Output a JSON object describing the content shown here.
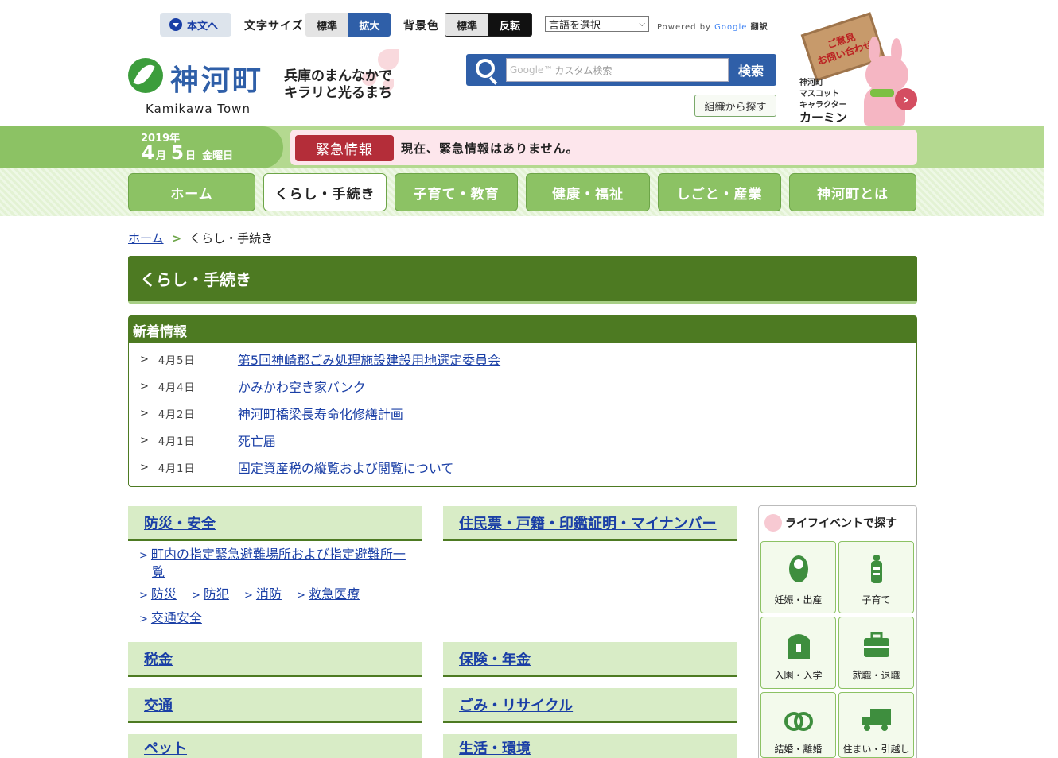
{
  "utility": {
    "skip_label": "本文へ",
    "font_size_label": "文字サイズ",
    "font_size_options": [
      "標準",
      "拡大"
    ],
    "bg_color_label": "背景色",
    "bg_color_options": [
      "標準",
      "反転"
    ],
    "language_select": "言語を選択",
    "powered_by": "Powered by",
    "google": "Google",
    "translate": "翻訳"
  },
  "header": {
    "logo_title": "神河町",
    "logo_en": "Kamikawa Town",
    "slogan_line1": "兵庫のまんなかで",
    "slogan_line2": "キラリと光るまち",
    "search_placeholder": "カスタム検索",
    "search_google": "Google™",
    "search_button": "検索",
    "org_button": "組織から探す",
    "mascot_sign": "ご意見\nお問い合わせ",
    "mascot_caption_1": "神河町",
    "mascot_caption_2": "マスコット",
    "mascot_caption_3": "キャラクター",
    "mascot_name": "カーミン"
  },
  "date": {
    "year": "2019年",
    "month": "4",
    "month_unit": "月",
    "day": "5",
    "day_unit": "日",
    "weekday": "金曜日"
  },
  "emergency": {
    "label": "緊急情報",
    "text": "現在、緊急情報はありません。"
  },
  "nav": [
    "ホーム",
    "くらし・手続き",
    "子育て・教育",
    "健康・福祉",
    "しごと・産業",
    "神河町とは"
  ],
  "breadcrumb": {
    "home": "ホーム",
    "current": "くらし・手続き"
  },
  "page_title": "くらし・手続き",
  "news": {
    "heading": "新着情報",
    "items": [
      {
        "date": "4月5日",
        "title": "第5回神崎郡ごみ処理施設建設用地選定委員会"
      },
      {
        "date": "4月4日",
        "title": "かみかわ空き家バンク"
      },
      {
        "date": "4月2日",
        "title": "神河町橋梁長寿命化修繕計画"
      },
      {
        "date": "4月1日",
        "title": "死亡届"
      },
      {
        "date": "4月1日",
        "title": "固定資産税の縦覧および閲覧について"
      }
    ]
  },
  "categories": {
    "bousai": "防災・安全",
    "bousai_links": [
      "町内の指定緊急避難場所および指定避難所一",
      "覧",
      "防災",
      "防犯",
      "消防",
      "救急医療",
      "交通安全"
    ],
    "juminhyo": "住民票・戸籍・印鑑証明・マイナンバー",
    "zeikin": "税金",
    "hoken": "保険・年金",
    "kotsu": "交通",
    "gomi": "ごみ・リサイクル",
    "pet": "ペット",
    "seikatsu": "生活・環境"
  },
  "life_events": {
    "title": "ライフイベントで探す",
    "tiles": [
      "妊娠・出産",
      "子育て",
      "入園・入学",
      "就職・退職",
      "結婚・離婚",
      "住まい・引越し"
    ]
  },
  "colors": {
    "primary_green": "#4d7a22",
    "light_green": "#8cc264",
    "link_blue": "#1a3fa6",
    "emergency_red": "#b42d39"
  }
}
